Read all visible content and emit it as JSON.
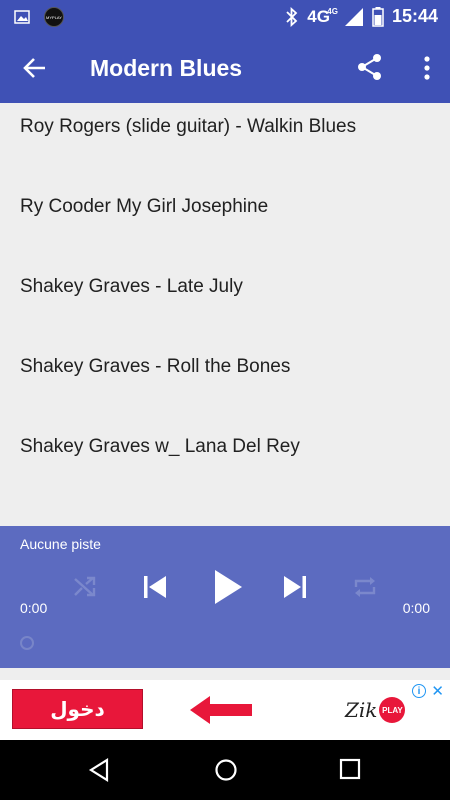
{
  "status_bar": {
    "time": "15:44",
    "network": "4G",
    "network_sup": "4G",
    "app_icon_text": "MYPLAY"
  },
  "app_bar": {
    "title": "Modern Blues"
  },
  "tracks": [
    "Roy Rogers (slide guitar) - Walkin Blues",
    "Ry Cooder My Girl Josephine",
    "Shakey Graves - Late July",
    "Shakey Graves - Roll the Bones",
    "Shakey Graves w_ Lana Del Rey"
  ],
  "player": {
    "now_playing": "Aucune piste",
    "elapsed": "0:00",
    "duration": "0:00"
  },
  "ad": {
    "button_label": "دخول",
    "brand": "Zik",
    "brand_badge": "PLAY"
  },
  "colors": {
    "primary": "#3f51b5",
    "player": "#5c6bc0",
    "ad_red": "#e8173a"
  }
}
